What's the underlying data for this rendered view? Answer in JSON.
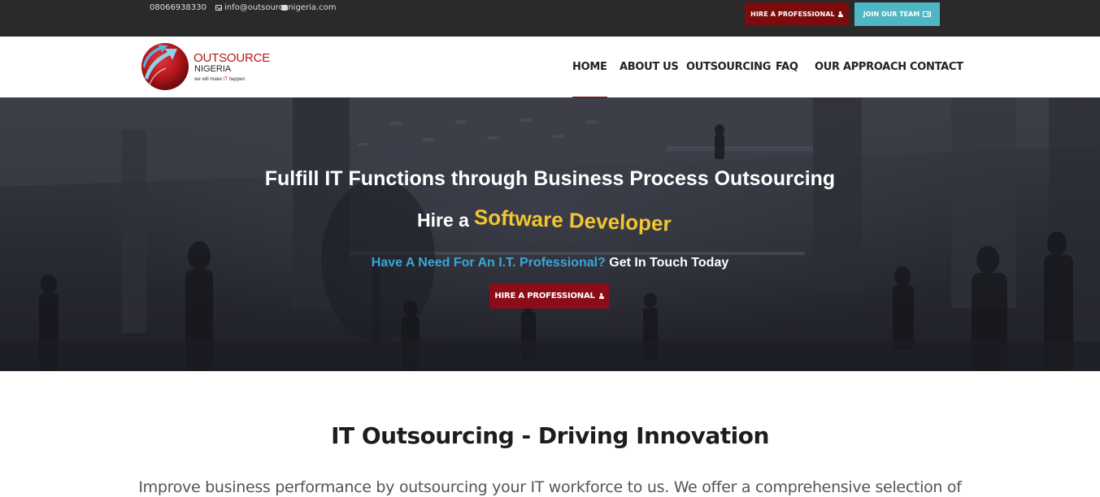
{
  "topbar": {
    "phone": "08066938330",
    "email": "info@outsourcenigeria.com",
    "hire_button": "HIRE A PROFESSIONAL",
    "join_button": "JOIN OUR TEAM"
  },
  "logo": {
    "line1": "OUTSOURCE",
    "line2": "NIGERIA",
    "tagline_pre": "we will make ",
    "tagline_it": "IT",
    "tagline_post": " happen"
  },
  "nav": {
    "items": [
      {
        "label": "HOME",
        "active": true
      },
      {
        "label": "ABOUT US"
      },
      {
        "label": "OUTSOURCING"
      },
      {
        "label": "FAQ"
      },
      {
        "label": "OUR APPROACH"
      },
      {
        "label": "CONTACT"
      }
    ]
  },
  "hero": {
    "title": "Fulfill IT Functions through Business Process Outsourcing",
    "hire_prefix": "Hire a",
    "role": "Software Developer",
    "sub_question": "Have A Need For An I.T. Professional?",
    "sub_cta": " Get In Touch Today",
    "button": "HIRE A PROFESSIONAL"
  },
  "section": {
    "title": "IT Outsourcing - Driving Innovation",
    "text": "Improve business performance by outsourcing your IT workforce to us. We offer a comprehensive selection of"
  },
  "colors": {
    "topbar_bg": "#2a2a2a",
    "brand_red": "#7a0c0c",
    "teal": "#4fb7c3",
    "accent_yellow": "#f2c531",
    "accent_blue": "#3aa6d8"
  }
}
